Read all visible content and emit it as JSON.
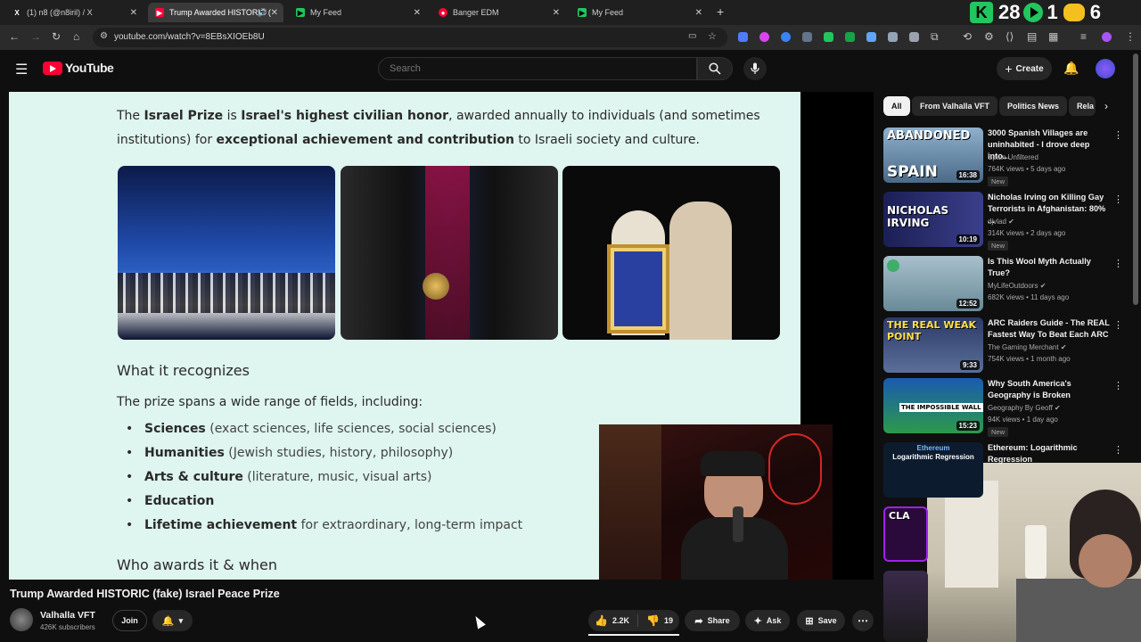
{
  "browser": {
    "tabs": [
      {
        "title": "(1) n8 (@n8iril) / X",
        "icon": "x-logo-icon",
        "color": "#ffffff"
      },
      {
        "title": "Trump Awarded HISTORIC (",
        "icon": "youtube-icon",
        "color": "#ff0033"
      },
      {
        "title": "My Feed",
        "icon": "feed-icon",
        "color": "#22c55e"
      },
      {
        "title": "Banger EDM",
        "icon": "music-icon",
        "color": "#ff0033"
      },
      {
        "title": "My Feed",
        "icon": "feed-icon",
        "color": "#22c55e"
      }
    ],
    "url": "youtube.com/watch?v=8EBsXIOEb8U",
    "overlay_counters": [
      "28",
      "1",
      "6"
    ]
  },
  "masthead": {
    "logo_text": "YouTube",
    "search_placeholder": "Search",
    "create_label": "Create"
  },
  "slide": {
    "intro_line1_a": "The ",
    "intro_line1_b": "Israel Prize",
    "intro_line1_c": " is ",
    "intro_line1_d": "Israel's highest civilian honor",
    "intro_line1_e": ", awarded annually to individuals (and sometimes",
    "intro_line2_a": "institutions) for ",
    "intro_line2_b": "exceptional achievement and contribution",
    "intro_line2_c": " to Israeli society and culture.",
    "heading1": "What it recognizes",
    "fields_intro": "The prize spans a wide range of fields, including:",
    "bullets": [
      {
        "bold": "Sciences",
        "rest": " (exact sciences, life sciences, social sciences)"
      },
      {
        "bold": "Humanities",
        "rest": " (Jewish studies, history, philosophy)"
      },
      {
        "bold": "Arts & culture",
        "rest": " (literature, music, visual arts)"
      },
      {
        "bold": "Education",
        "rest": ""
      },
      {
        "bold": "Lifetime achievement",
        "rest": " for extraordinary, long-term impact"
      }
    ],
    "heading2": "Who awards it & when"
  },
  "video": {
    "title": "Trump Awarded HISTORIC (fake) Israel Peace Prize",
    "channel": "Valhalla VFT",
    "subscribers": "426K subscribers",
    "join_label": "Join",
    "likes": "2.2K",
    "dislikes": "19",
    "share_label": "Share",
    "ask_label": "Ask",
    "save_label": "Save"
  },
  "chips": [
    "All",
    "From Valhalla VFT",
    "Politics News",
    "Rela"
  ],
  "recommendations": [
    {
      "title": "3000 Spanish Villages are uninhabited - I drove deep into...",
      "channel": "Spain Unfiltered",
      "meta": "764K views • 5 days ago",
      "badge": "New",
      "duration": "16:38",
      "thumb_text": "ABANDONED SPAIN",
      "thumb_color": "#6a8aa8",
      "verified": false
    },
    {
      "title": "Nicholas Irving on Killing Gay Terrorists in Afghanistan: 80% ...",
      "channel": "djvlad",
      "meta": "314K views • 2 days ago",
      "badge": "New",
      "duration": "10:19",
      "thumb_text": "NICHOLAS IRVING",
      "thumb_color": "#2b2f6a",
      "verified": true
    },
    {
      "title": "Is This Wool Myth Actually True?",
      "channel": "MyLifeOutdoors",
      "meta": "682K views • 11 days ago",
      "badge": "",
      "duration": "12:52",
      "thumb_text": "",
      "thumb_color": "#8fa7b3",
      "verified": true
    },
    {
      "title": "ARC Raiders Guide - The REAL Fastest Way To Beat Each ARC",
      "channel": "The Gaming Merchant",
      "meta": "754K views • 1 month ago",
      "badge": "",
      "duration": "9:33",
      "thumb_text": "THE REAL WEAK POINT",
      "thumb_color": "#3a4d78",
      "verified": true
    },
    {
      "title": "Why South America's Geography is Broken",
      "channel": "Geography By Geoff",
      "meta": "94K views • 1 day ago",
      "badge": "New",
      "duration": "15:23",
      "thumb_text": "THE IMPOSSIBLE WALL",
      "thumb_color": "#1f5aa0",
      "verified": true
    },
    {
      "title": "Ethereum: Logarithmic Regression",
      "channel": "",
      "meta": "",
      "badge": "",
      "duration": "",
      "thumb_text": "Ethereum Logarithmic Regression",
      "thumb_color": "#0d1b2e",
      "verified": false
    }
  ]
}
